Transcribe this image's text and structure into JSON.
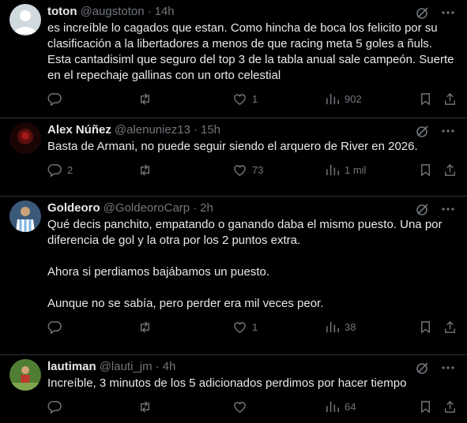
{
  "tweets": [
    {
      "name": "toton",
      "handle": "@augstoton",
      "time": "14h",
      "text": "es increíble lo cagados que estan. Como hincha de boca los felicito por su clasificación a la libertadores a menos de que racing meta 5 goles a ñuls. Esta cantadisiml que seguro del top 3 de la tabla anual sale campeón. Suerte en el repechaje gallinas con un orto celestial",
      "replies": "",
      "retweets": "",
      "likes": "1",
      "views": "902",
      "avatar_color": "#cfd9de"
    },
    {
      "name": "Alex Núñez",
      "handle": "@alenuniez13",
      "time": "15h",
      "text": "Basta de Armani, no puede seguir siendo el arquero de River en 2026.",
      "replies": "2",
      "retweets": "",
      "likes": "73",
      "views": "1 mil",
      "avatar_color": "#2a0a0a"
    },
    {
      "name": "Goldeoro",
      "handle": "@GoldeoroCarp",
      "time": "2h",
      "text": "Qué decis panchito, empatando o ganando daba el mismo puesto. Una por diferencia de gol y la otra por los 2 puntos extra.\n\nAhora si perdiamos bajábamos un puesto.\n\nAunque no se sabía, pero perder era mil veces peor.",
      "replies": "",
      "retweets": "",
      "likes": "1",
      "views": "38",
      "avatar_color": "#6b8fb5"
    },
    {
      "name": "lautiman",
      "handle": "@lauti_jm",
      "time": "4h",
      "text": "Increíble, 3 minutos de los 5 adicionados perdimos por hacer tiempo",
      "replies": "",
      "retweets": "",
      "likes": "",
      "views": "64",
      "avatar_color": "#5a8a3a"
    }
  ],
  "icons": {
    "grok": "grok-icon",
    "more": "more-icon",
    "reply": "reply-icon",
    "retweet": "retweet-icon",
    "like": "like-icon",
    "views": "views-icon",
    "bookmark": "bookmark-icon",
    "share": "share-icon"
  },
  "colors": {
    "background": "#000000",
    "text": "#e7e9ea",
    "secondary": "#71767b",
    "divider": "#2f3336"
  }
}
